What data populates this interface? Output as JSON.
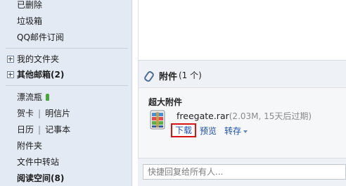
{
  "sidebar": {
    "deleted": "已删除",
    "trash": "垃圾箱",
    "qq_subscribe": "QQ邮件订阅",
    "my_folders": "我的文件夹",
    "other_mailboxes": "其他邮箱(2)",
    "drift_bottle": "漂流瓶",
    "greeting_card": "贺卡",
    "postcard": "明信片",
    "calendar": "日历",
    "notepad": "记事本",
    "attachment_folder": "附件夹",
    "file_transfer": "文件中转站",
    "reading_space": "阅读空间(8)",
    "separator": "|"
  },
  "attachment": {
    "title": "附件",
    "count": "(1 个)",
    "super_label": "超大附件",
    "file_name": "freegate.rar",
    "file_meta": "(2.03M, 15天后过期)",
    "download": "下载",
    "preview": "预览",
    "save": "转存"
  },
  "reply": {
    "placeholder": "快捷回复给所有人..."
  },
  "colors": {
    "sidebar_bg": "#e4eaf3",
    "link": "#1b4fb0",
    "highlight_border": "#d61414"
  }
}
